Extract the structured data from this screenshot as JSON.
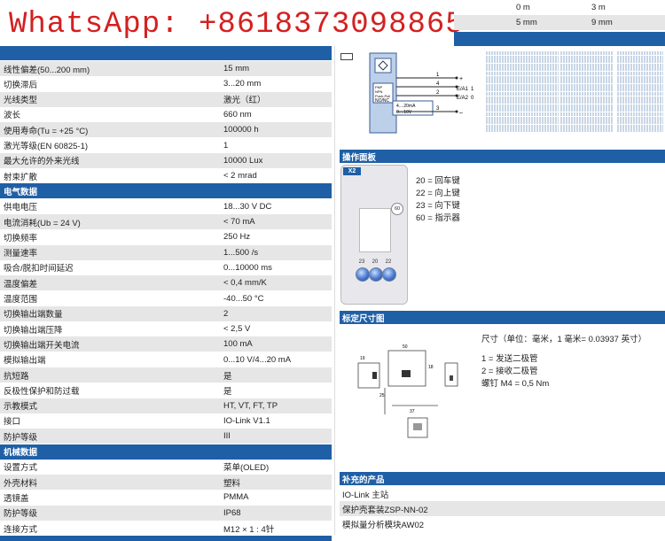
{
  "watermark": "WhatsApp: +8618373098865",
  "distance_table": [
    {
      "a": "0 m",
      "b": "3 m"
    },
    {
      "a": "5 mm",
      "b": "9 mm"
    }
  ],
  "spec_rows": [
    {
      "k": "线性偏差(50...200 mm)",
      "v": "15 mm"
    },
    {
      "k": "切换滞后",
      "v": "3...20 mm"
    },
    {
      "k": "光线类型",
      "v": "激光（红）"
    },
    {
      "k": "波长",
      "v": "660 nm"
    },
    {
      "k": "使用寿命(Tu = +25 °C)",
      "v": "100000 h"
    },
    {
      "k": "激光等级(EN 60825-1)",
      "v": "1"
    },
    {
      "k": "最大允许的外来光线",
      "v": "10000 Lux"
    },
    {
      "k": "射束扩散",
      "v": "< 2 mrad"
    }
  ],
  "sections": {
    "electrical": "电气数据",
    "mechanical": "机械数据",
    "wiring": "操作面板",
    "dimensions": "标定尺寸图",
    "accessories": "补充的产品"
  },
  "electrical_rows": [
    {
      "k": "供电电压",
      "v": "18...30 V DC"
    },
    {
      "k": "电流消耗(Ub = 24 V)",
      "v": "< 70 mA"
    },
    {
      "k": "切换频率",
      "v": "250 Hz"
    },
    {
      "k": "测量速率",
      "v": "1...500 /s"
    },
    {
      "k": "吸合/脱扣时间延迟",
      "v": "0...10000 ms"
    },
    {
      "k": "温度偏差",
      "v": "< 0,4 mm/K"
    },
    {
      "k": "温度范围",
      "v": "-40...50 °C"
    },
    {
      "k": "切换输出端数量",
      "v": "2"
    },
    {
      "k": "切换输出端压降",
      "v": "< 2,5 V"
    },
    {
      "k": "切换输出端开关电流",
      "v": "100 mA"
    },
    {
      "k": "模拟输出端",
      "v": "0...10 V/4...20 mA"
    },
    {
      "k": "抗短路",
      "v": "是"
    },
    {
      "k": "反极性保护和防过载",
      "v": "是"
    },
    {
      "k": "示教模式",
      "v": "HT, VT, FT, TP"
    },
    {
      "k": "接口",
      "v": "IO-Link V1.1"
    },
    {
      "k": "防护等级",
      "v": "III"
    }
  ],
  "mechanical_rows": [
    {
      "k": "设置方式",
      "v": "菜单(OLED)"
    },
    {
      "k": "外壳材料",
      "v": "塑料"
    },
    {
      "k": "透镜盖",
      "v": "PMMA"
    },
    {
      "k": "防护等级",
      "v": "IP68"
    },
    {
      "k": "连接方式",
      "v": "M12 × 1 : 4针"
    }
  ],
  "wiring": {
    "pins": [
      "1",
      "4",
      "2",
      "3"
    ],
    "signals": [
      "+",
      "E/A1",
      "E/A2",
      "–"
    ],
    "box_lines": [
      "PNP",
      "NPN",
      "Push-Pull",
      "NO/NC"
    ],
    "analog_lines": [
      "4....20mA",
      "0....10V"
    ],
    "marks": [
      "1",
      "0"
    ]
  },
  "panel": {
    "badge": "X2",
    "display_label": "60",
    "buttons": [
      "23",
      "20",
      "22"
    ],
    "legend": [
      "20 = 回车键",
      "22 = 向上键",
      "23 = 向下键",
      "60 = 指示器"
    ]
  },
  "dimensions": {
    "note": "尺寸（单位：毫米，1 毫米= 0.03937 英寸）",
    "items": [
      "1 = 发送二极管",
      "2 = 接收二极管",
      "螺钉 M4 = 0,5 Nm"
    ],
    "labels": [
      "50",
      "18",
      "19",
      "25",
      "37"
    ]
  },
  "accessories": [
    "IO-Link 主站",
    "保护壳套装ZSP-NN-02",
    "模拟量分析模块AW02"
  ]
}
